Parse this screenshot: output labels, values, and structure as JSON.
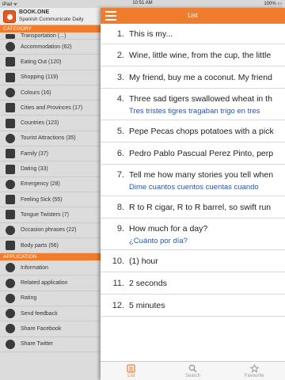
{
  "status": {
    "left": "iPad ᯤ",
    "time": "10:51 AM",
    "right": "100% ▭"
  },
  "brand": {
    "line1": "BOOK.ONE",
    "line2": "Spanish Communicate Daily"
  },
  "sidebar": {
    "category_header": "CATEGORY",
    "categories": [
      {
        "label": "Transportation (...)",
        "icon": "bus-icon"
      },
      {
        "label": "Accommodation (62)",
        "icon": "house-icon"
      },
      {
        "label": "Eating Out (120)",
        "icon": "fork-knife-icon"
      },
      {
        "label": "Shopping (119)",
        "icon": "cart-icon"
      },
      {
        "label": "Colours (16)",
        "icon": "palette-icon"
      },
      {
        "label": "Cities and Provinces (17)",
        "icon": "buildings-icon"
      },
      {
        "label": "Countries (123)",
        "icon": "globe-icon"
      },
      {
        "label": "Tourist Attractions (35)",
        "icon": "tourist-icon"
      },
      {
        "label": "Family (37)",
        "icon": "family-icon"
      },
      {
        "label": "Dating (33)",
        "icon": "dating-icon"
      },
      {
        "label": "Emergency (28)",
        "icon": "emergency-icon"
      },
      {
        "label": "Feeling Sick (55)",
        "icon": "sick-icon"
      },
      {
        "label": "Tongue Twisters (7)",
        "icon": "tongue-icon"
      },
      {
        "label": "Occasion phrases (22)",
        "icon": "occasion-icon"
      },
      {
        "label": "Body parts (56)",
        "icon": "body-icon"
      }
    ],
    "application_header": "APPLICATION",
    "app_items": [
      {
        "label": "Information",
        "icon": "info-icon"
      },
      {
        "label": "Related application",
        "icon": "share-icon"
      },
      {
        "label": "Rating",
        "icon": "star-icon"
      },
      {
        "label": "Send feedback",
        "icon": "mail-icon"
      },
      {
        "label": "Share Facebook",
        "icon": "facebook-icon"
      },
      {
        "label": "Share Twitter",
        "icon": "twitter-icon"
      }
    ]
  },
  "header": {
    "title": "List",
    "menu_icon": "hamburger-icon"
  },
  "phrases": [
    {
      "num": "1.",
      "en": "This is my...",
      "es": ""
    },
    {
      "num": "2.",
      "en": "Wine, little wine, from the cup, the little",
      "es": ""
    },
    {
      "num": "3.",
      "en": "My friend, buy me a coconut. My friend",
      "es": ""
    },
    {
      "num": "4.",
      "en": "Three sad tigers swallowed wheat in th",
      "es": "Tres tristes tigres tragaban trigo en tres"
    },
    {
      "num": "5.",
      "en": "Pepe Pecas chops potatoes with a pick",
      "es": ""
    },
    {
      "num": "6.",
      "en": "Pedro Pablo Pascual Perez Pinto, perp",
      "es": ""
    },
    {
      "num": "7.",
      "en": "Tell me how many stories you tell when",
      "es": "Dime cuantos cuentos cuentas cuando"
    },
    {
      "num": "8.",
      "en": "R to R cigar, R to R barrel, so swift run",
      "es": ""
    },
    {
      "num": "9.",
      "en": "How much for a day?",
      "es": "¿Cuánto por día?"
    },
    {
      "num": "10.",
      "en": "(1) hour",
      "es": ""
    },
    {
      "num": "11.",
      "en": "2 seconds",
      "es": ""
    },
    {
      "num": "12.",
      "en": "5 minutes",
      "es": ""
    }
  ],
  "tabs": [
    {
      "label": "List",
      "icon": "list-icon",
      "active": true
    },
    {
      "label": "Search",
      "icon": "search-icon",
      "active": false
    },
    {
      "label": "Favourite",
      "icon": "star-icon",
      "active": false
    }
  ],
  "colors": {
    "accent": "#f07c2e",
    "translation": "#2a55a8",
    "sidebar_bg": "#dcdcdc"
  }
}
